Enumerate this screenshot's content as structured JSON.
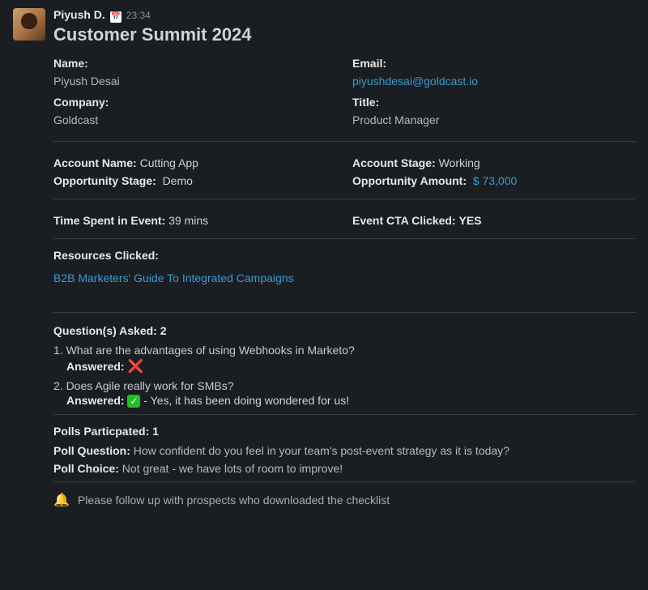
{
  "header": {
    "poster": "Piyush D.",
    "app_icon": "📅",
    "timestamp": "23:34",
    "event_title": "Customer Summit 2024"
  },
  "contact": {
    "name_label": "Name:",
    "name_value": "Piyush Desai",
    "company_label": "Company:",
    "company_value": "Goldcast",
    "email_label": "Email:",
    "email_value": "piyushdesai@goldcast.io",
    "title_label": "Title:",
    "title_value": "Product Manager"
  },
  "account": {
    "account_name_label": "Account Name:",
    "account_name_value": "Cutting App",
    "opportunity_stage_label": "Opportunity Stage:",
    "opportunity_stage_value": "Demo",
    "account_stage_label": "Account Stage:",
    "account_stage_value": "Working",
    "opportunity_amount_label": "Opportunity Amount:",
    "opportunity_amount_value": "$ 73,000"
  },
  "engagement": {
    "time_label": "Time Spent in Event:",
    "time_value": "39 mins",
    "cta_label": "Event CTA Clicked:",
    "cta_value": "YES"
  },
  "resources": {
    "label": "Resources Clicked:",
    "link": "B2B Marketers' Guide To Integrated Campaigns"
  },
  "questions": {
    "label": "Question(s) Asked: 2",
    "answered_label": "Answered:",
    "item1_text": "1. What are the advantages of using Webhooks in Marketo?",
    "item1_icon": "❌",
    "item2_text": "2. Does Agile really work for SMBs?",
    "item2_icon": "✓",
    "item2_answer": " - Yes, it has been doing wondered for us!"
  },
  "polls": {
    "label": "Polls Particpated: 1",
    "poll_q_label": "Poll Question:",
    "poll_q_text": "How confident do you feel in your team's post-event strategy as it is today?",
    "poll_c_label": "Poll Choice:",
    "poll_c_text": "Not great - we have lots of room to improve!"
  },
  "footer": {
    "bell": "🔔",
    "text": "Please follow up with prospects who downloaded the checklist"
  }
}
